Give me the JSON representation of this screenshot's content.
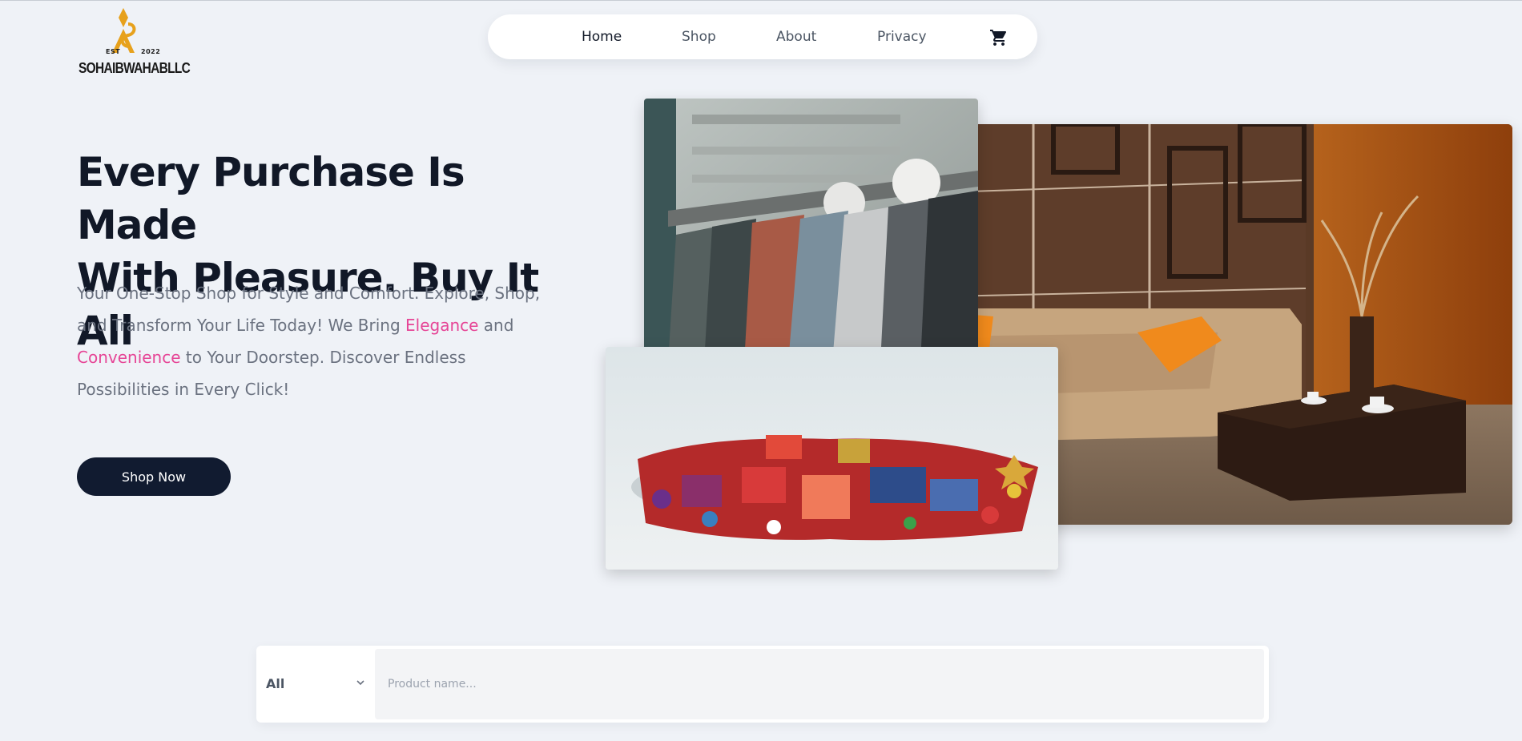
{
  "brand": {
    "name": "SOHAIBWAHABLLC",
    "est_label": "EST",
    "est_year": "2022",
    "gold_color": "#e7a11c"
  },
  "nav": {
    "items": [
      {
        "label": "Home",
        "active": true
      },
      {
        "label": "Shop",
        "active": false
      },
      {
        "label": "About",
        "active": false
      },
      {
        "label": "Privacy",
        "active": false
      }
    ],
    "cart_icon": "shopping-cart-icon"
  },
  "hero": {
    "title_line1": "Every Purchase Is Made",
    "title_line2": "With Pleasure. Buy It All",
    "text_part1": "Your One-Stop Shop for Style and Comfort. Explore, Shop, and Transform Your Life Today! We Bring ",
    "highlight1": "Elegance",
    "text_part2": " and ",
    "highlight2": "Convenience",
    "text_part3": " to Your Doorstep. Discover Endless Possibilities in Every Click!",
    "cta_label": "Shop Now",
    "highlight_color": "#e64596"
  },
  "search": {
    "category": "All",
    "placeholder": "Product name..."
  },
  "colors": {
    "background": "#eff2f7",
    "dark": "#111b30"
  }
}
